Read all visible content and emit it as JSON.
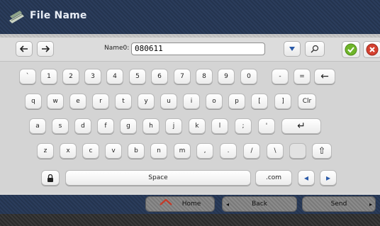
{
  "window": {
    "title": "File Name"
  },
  "toolbar": {
    "field_label": "Name0:",
    "name_value": "080611",
    "left_arrow_icon": "arrow-left-icon",
    "right_arrow_icon": "arrow-right-icon",
    "dropdown_icon": "chevron-down-icon",
    "search_icon": "search-icon",
    "ok_icon": "check-icon",
    "cancel_icon": "close-icon"
  },
  "keyboard": {
    "row1": [
      "`",
      "1",
      "2",
      "3",
      "4",
      "5",
      "6",
      "7",
      "8",
      "9",
      "0",
      "-",
      "=",
      "←"
    ],
    "row2": [
      "q",
      "w",
      "e",
      "r",
      "t",
      "y",
      "u",
      "i",
      "o",
      "p",
      "[",
      "]",
      "Clr"
    ],
    "row3": [
      "a",
      "s",
      "d",
      "f",
      "g",
      "h",
      "j",
      "k",
      "l",
      ";",
      "'",
      "↵"
    ],
    "row4": [
      "z",
      "x",
      "c",
      "v",
      "b",
      "n",
      "m",
      ",",
      ".",
      "/",
      "\\",
      "",
      "⇧"
    ],
    "row5": {
      "lock_icon": "lock-icon",
      "space": "Space",
      "com": ".com",
      "left": "◂",
      "right": "▸"
    }
  },
  "nav": {
    "home": "Home",
    "back": "Back",
    "send": "Send"
  },
  "colors": {
    "accent": "#2b3d5c",
    "ok": "#6fb52a",
    "cancel": "#d4402f"
  }
}
